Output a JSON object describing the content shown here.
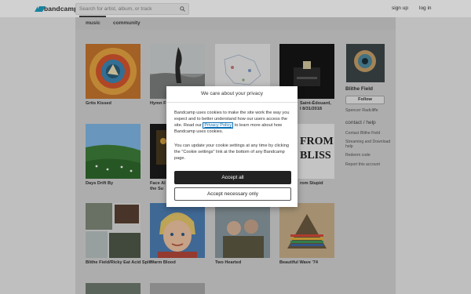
{
  "header": {
    "logo_text": "bandcamp",
    "search_placeholder": "Search for artist, album, or track",
    "sign_up": "sign up",
    "log_in": "log in"
  },
  "subnav": {
    "tabs": [
      {
        "label": "music",
        "active": true
      },
      {
        "label": "community",
        "active": false
      }
    ]
  },
  "albums": [
    {
      "title": "Grits Kissed"
    },
    {
      "title": "Hymn F"
    },
    {
      "title": ""
    },
    {
      "title": "Saint-Édouard,"
    },
    {
      "title": "Days Drift By"
    },
    {
      "title": "Face Al"
    },
    {
      "title": "the Su"
    },
    {
      "title": "rom Stupid"
    },
    {
      "title": "Blithe Field/Ricky Eat Acid Split"
    },
    {
      "title": "Warm Blood"
    },
    {
      "title": "Two Hearted"
    },
    {
      "title": "Beautiful Wave '74"
    }
  ],
  "album_caption_partial": {
    "saint_line2": "l 8/31/2018"
  },
  "sidebar": {
    "artist_name": "Blithe Field",
    "follow_label": "Follow",
    "artist_sub": "Spencer Radcliffe",
    "contact_heading": "contact / help",
    "links": [
      "Contact Blithe Field",
      "Streaming and Download help",
      "Redeem code",
      "Report this account"
    ]
  },
  "cookie_modal": {
    "title": "We care about your privacy",
    "para1_before": "Bandcamp uses cookies to make the site work the way you expect and to better understand how our users access the site. Read our ",
    "privacy_link": "Privacy Policy",
    "para1_after": " to learn more about how Bandcamp uses cookies.",
    "para2": "You can update your cookie settings at any time by clicking the \"Cookie settings\" link at the bottom of any Bandcamp page.",
    "accept_all": "Accept all",
    "accept_necessary": "Accept necessary only"
  },
  "colors": {
    "brand": "#1da0c3",
    "accept_button_bg": "#222222",
    "link": "#0a6fb5"
  }
}
